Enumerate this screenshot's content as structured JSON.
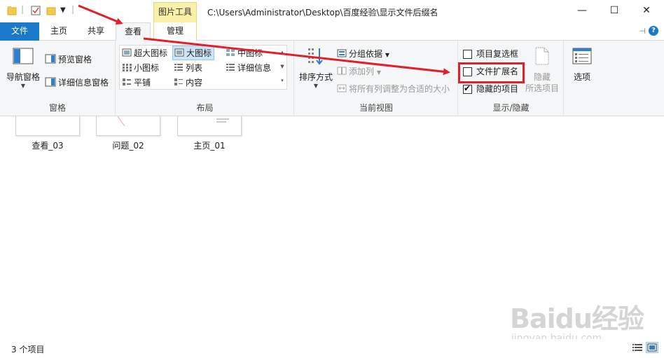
{
  "titlebar": {
    "path": "C:\\Users\\Administrator\\Desktop\\百度经验\\显示文件后缀名",
    "context_group": "图片工具",
    "minimize": "—",
    "maximize": "☐",
    "close": "✕"
  },
  "tabs": {
    "file": "文件",
    "home": "主页",
    "share": "共享",
    "view": "查看",
    "manage": "管理"
  },
  "ribbon": {
    "panes": {
      "label": "窗格",
      "nav_pane": "导航窗格",
      "preview_pane": "预览窗格",
      "details_pane": "详细信息窗格"
    },
    "layout": {
      "label": "布局",
      "extra_large": "超大图标",
      "large": "大图标",
      "medium": "中图标",
      "small": "小图标",
      "list": "列表",
      "details": "详细信息",
      "tiles": "平铺",
      "content": "内容"
    },
    "current_view": {
      "label": "当前视图",
      "sort_by": "排序方式",
      "group_by": "分组依据",
      "add_columns": "添加列",
      "size_columns": "将所有列调整为合适的大小"
    },
    "show_hide": {
      "label": "显示/隐藏",
      "item_checkboxes": "项目复选框",
      "file_extensions": "文件扩展名",
      "hidden_items": "隐藏的项目",
      "hide_selected_1": "隐藏",
      "hide_selected_2": "所选项目",
      "item_checkboxes_checked": false,
      "file_extensions_checked": false,
      "hidden_items_checked": true
    },
    "options": {
      "label": "选项"
    }
  },
  "files": [
    {
      "name": "查看_03"
    },
    {
      "name": "问题_02"
    },
    {
      "name": "主页_01"
    }
  ],
  "status": {
    "count": "3 个项目"
  },
  "watermark": {
    "logo": "Baidu经验",
    "url": "jingyan.baidu.com"
  },
  "colors": {
    "accent": "#1979ca",
    "ribbon_bg": "#f5f6f7",
    "context_tab": "#fbf0a8",
    "annotation": "#e0202a"
  }
}
